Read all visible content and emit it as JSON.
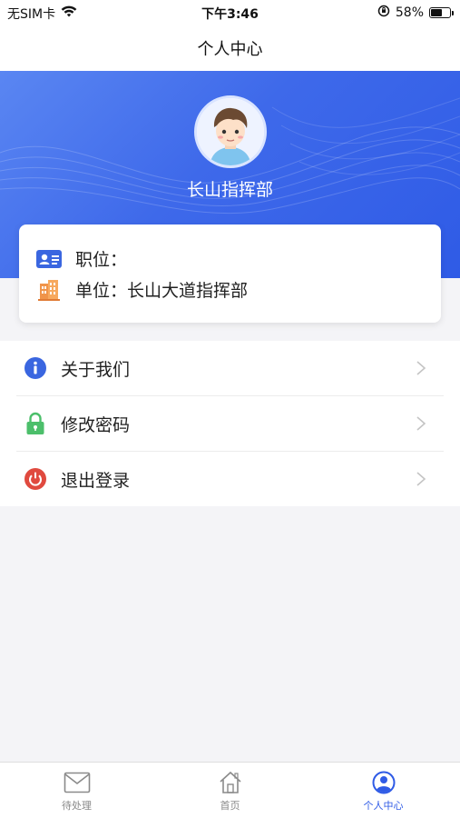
{
  "status_bar": {
    "carrier": "无SIM卡",
    "time": "下午3:46",
    "battery_percent": "58%",
    "battery_level": 0.58
  },
  "nav": {
    "title": "个人中心"
  },
  "profile": {
    "name": "长山指挥部"
  },
  "info": {
    "position_label": "职位：",
    "position_value": "",
    "unit_label": "单位：",
    "unit_value": "长山大道指挥部"
  },
  "menu": {
    "items": [
      {
        "label": "关于我们",
        "icon": "info-icon",
        "color": "#3a66e0"
      },
      {
        "label": "修改密码",
        "icon": "lock-icon",
        "color": "#4cbf6b"
      },
      {
        "label": "退出登录",
        "icon": "power-icon",
        "color": "#e04a3f"
      }
    ]
  },
  "tabs": [
    {
      "label": "待处理",
      "icon": "mail-icon"
    },
    {
      "label": "首页",
      "icon": "home-icon"
    },
    {
      "label": "个人中心",
      "icon": "user-icon",
      "active": true
    }
  ],
  "colors": {
    "accent": "#2f5be6",
    "hero_start": "#5a86f2",
    "hero_end": "#2f5be6",
    "background": "#f4f4f7"
  }
}
